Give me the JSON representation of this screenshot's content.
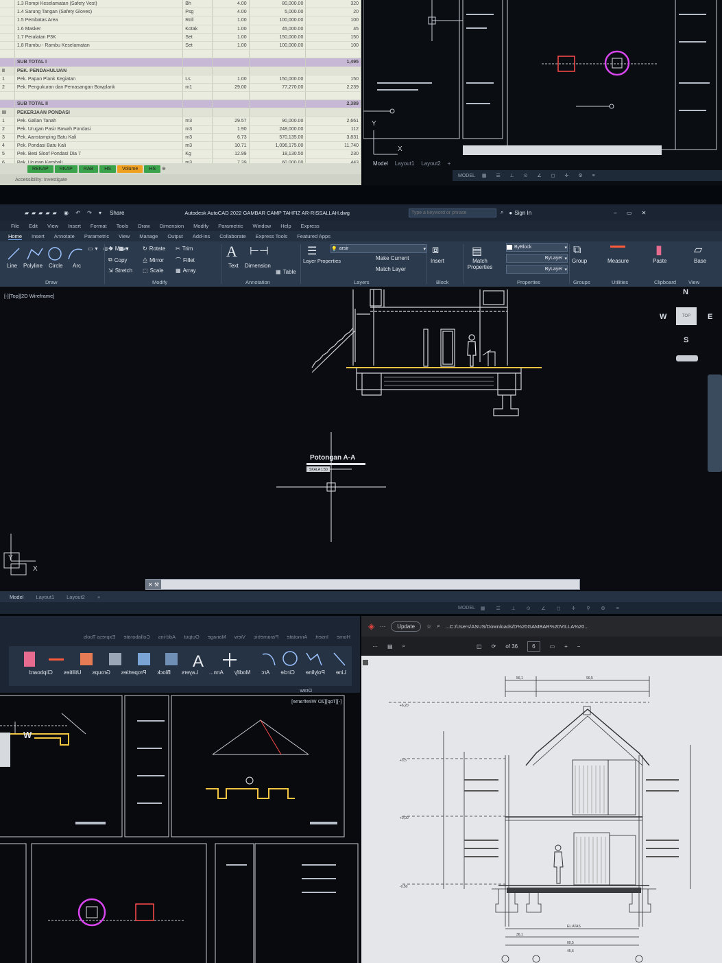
{
  "spreadsheet": {
    "rows": [
      {
        "kind": "item",
        "no": "",
        "desc": "1.3  Rompi Keselamatan (Safety Vest)",
        "unit": "Bh",
        "qty": "4.00",
        "price": "80,000.00",
        "total": "320"
      },
      {
        "kind": "item",
        "no": "",
        "desc": "1.4  Sarung Tangan (Safety Gloves)",
        "unit": "Psg",
        "qty": "4.00",
        "price": "5,000.00",
        "total": "20"
      },
      {
        "kind": "item",
        "no": "",
        "desc": "1.5  Pembatas Area",
        "unit": "Roll",
        "qty": "1.00",
        "price": "100,000.00",
        "total": "100"
      },
      {
        "kind": "item",
        "no": "",
        "desc": "1.6  Masker",
        "unit": "Kotak",
        "qty": "1.00",
        "price": "45,000.00",
        "total": "45"
      },
      {
        "kind": "item",
        "no": "",
        "desc": "1.7  Peralatan P3K",
        "unit": "Set",
        "qty": "1.00",
        "price": "150,000.00",
        "total": "150"
      },
      {
        "kind": "item",
        "no": "",
        "desc": "1.8  Rambu - Rambu Keselamatan",
        "unit": "Set",
        "qty": "1.00",
        "price": "100,000.00",
        "total": "100"
      },
      {
        "kind": "blank",
        "no": "",
        "desc": "",
        "unit": "",
        "qty": "",
        "price": "",
        "total": ""
      },
      {
        "kind": "sub",
        "no": "",
        "desc": "SUB TOTAL I",
        "unit": "",
        "qty": "",
        "price": "",
        "total": "1,495"
      },
      {
        "kind": "sec",
        "no": "II",
        "desc": "PEK. PENDAHULUAN",
        "unit": "",
        "qty": "",
        "price": "",
        "total": ""
      },
      {
        "kind": "item",
        "no": "1",
        "desc": "Pek. Papan Plank Kegiatan",
        "unit": "Ls",
        "qty": "1.00",
        "price": "150,000.00",
        "total": "150"
      },
      {
        "kind": "item",
        "no": "2",
        "desc": "Pek. Pengukuran dan Pemasangan Bowplank",
        "unit": "m1",
        "qty": "29.00",
        "price": "77,270.00",
        "total": "2,239"
      },
      {
        "kind": "blank",
        "no": "",
        "desc": "",
        "unit": "",
        "qty": "",
        "price": "",
        "total": ""
      },
      {
        "kind": "sub",
        "no": "",
        "desc": "SUB TOTAL II",
        "unit": "",
        "qty": "",
        "price": "",
        "total": "2,389"
      },
      {
        "kind": "sec",
        "no": "III",
        "desc": "PEKERJAAN PONDASI",
        "unit": "",
        "qty": "",
        "price": "",
        "total": ""
      },
      {
        "kind": "item",
        "no": "1",
        "desc": "Pek. Galian Tanah",
        "unit": "m3",
        "qty": "29.57",
        "price": "90,000.00",
        "total": "2,661"
      },
      {
        "kind": "item",
        "no": "2",
        "desc": "Pek. Urugan Pasir Bawah Pondasi",
        "unit": "m3",
        "qty": "1.90",
        "price": "248,000.00",
        "total": "112"
      },
      {
        "kind": "item",
        "no": "3",
        "desc": "Pek. Aanstamping Batu Kali",
        "unit": "m3",
        "qty": "6.73",
        "price": "570,135.00",
        "total": "3,831"
      },
      {
        "kind": "item",
        "no": "4",
        "desc": "Pek. Pondasi Batu Kali",
        "unit": "m3",
        "qty": "10.71",
        "price": "1,096,175.00",
        "total": "11,740"
      },
      {
        "kind": "item",
        "no": "5",
        "desc": "Pek. Besi Sloof Pondasi Dia 7",
        "unit": "Kg",
        "qty": "12.99",
        "price": "18,130.50",
        "total": "230"
      },
      {
        "kind": "item",
        "no": "6",
        "desc": "Pek. Urugan Kembali",
        "unit": "m3",
        "qty": "7.39",
        "price": "60,000.00",
        "total": "443"
      }
    ],
    "tabs": [
      {
        "label": "REKAP",
        "color": "#3aa34b"
      },
      {
        "label": "RKAP",
        "color": "#3aa34b"
      },
      {
        "label": "RAB",
        "color": "#3aa34b"
      },
      {
        "label": "HS",
        "color": "#3aa34b"
      },
      {
        "label": "Volume",
        "color": "#f0a020"
      },
      {
        "label": "HS",
        "color": "#3aa34b"
      }
    ],
    "status": "Accessibility: Investigate"
  },
  "cad_top": {
    "tabs": [
      "Model",
      "Layout1",
      "Layout2"
    ],
    "status_model": "MODEL"
  },
  "autocad": {
    "title": "Autodesk AutoCAD 2022   GAMBAR CAMP TAHFIZ AR-RISSALLAH.dwg",
    "share": "Share",
    "search_placeholder": "Type a keyword or phrase",
    "sign_in": "Sign In",
    "menus": [
      "File",
      "Edit",
      "View",
      "Insert",
      "Format",
      "Tools",
      "Draw",
      "Dimension",
      "Modify",
      "Parametric",
      "Window",
      "Help",
      "Express"
    ],
    "ribbon_tabs": [
      "Home",
      "Insert",
      "Annotate",
      "Parametric",
      "View",
      "Manage",
      "Output",
      "Add-ins",
      "Collaborate",
      "Express Tools",
      "Featured Apps"
    ],
    "draw_tools": [
      "Line",
      "Polyline",
      "Circle",
      "Arc"
    ],
    "modify_tools": [
      "Move",
      "Rotate",
      "Trim",
      "Copy",
      "Mirror",
      "Fillet",
      "Stretch",
      "Scale",
      "Array"
    ],
    "annotation_tools": [
      "Text",
      "Dimension",
      "Table"
    ],
    "layer_tools": [
      "Layer Properties",
      "Make Current",
      "Match Layer"
    ],
    "layer_name": "arsir",
    "insert_label": "Insert",
    "match_props": "Match Properties",
    "prop_bylayer": "ByBlock",
    "prop_layer1": "ByLayer",
    "prop_layer2": "ByLayer",
    "group_label": "Group",
    "measure_label": "Measure",
    "paste_label": "Paste",
    "base_label": "Base",
    "panels": [
      "Draw",
      "Modify",
      "Annotation",
      "Layers",
      "Block",
      "Properties",
      "Groups",
      "Utilities",
      "Clipboard",
      "View"
    ],
    "viewport_label": "[-][Top][2D Wireframe]",
    "compass": {
      "n": "N",
      "s": "S",
      "e": "E",
      "w": "W",
      "top": "TOP"
    },
    "section_title": "Potongan A-A",
    "section_scale": "SKALA 1:50",
    "layout_tabs": [
      "Model",
      "Layout1",
      "Layout2"
    ],
    "status_model": "MODEL"
  },
  "cad_bottom_left": {
    "ribbon": [
      "Home",
      "Insert",
      "Annotate",
      "Parametric",
      "View",
      "Manage",
      "Output",
      "Add-ins",
      "Collaborate",
      "Express Tools"
    ],
    "tools": [
      "Line",
      "Polyline",
      "Circle",
      "Arc",
      "Modify",
      "Ann...",
      "Layers",
      "Block",
      "Properties",
      "Groups",
      "Utilities",
      "Clipboard"
    ],
    "draw": "Draw",
    "view": "[-][Top][2D Wireframe]"
  },
  "pdf": {
    "update": "Update",
    "url": "...C:/Users/ASUS/Downloads/D%20GAMBAR%20VILLA%20...",
    "page_of": "of 36",
    "page": "6",
    "dims_top": [
      "56,1",
      "90,5"
    ],
    "dims_bottom": [
      "EL.ATAS",
      "36,1",
      "00,5",
      "45,6"
    ],
    "elev_labels": [
      "+6,20",
      "+3,5",
      "+0,00",
      "-0,50"
    ]
  }
}
